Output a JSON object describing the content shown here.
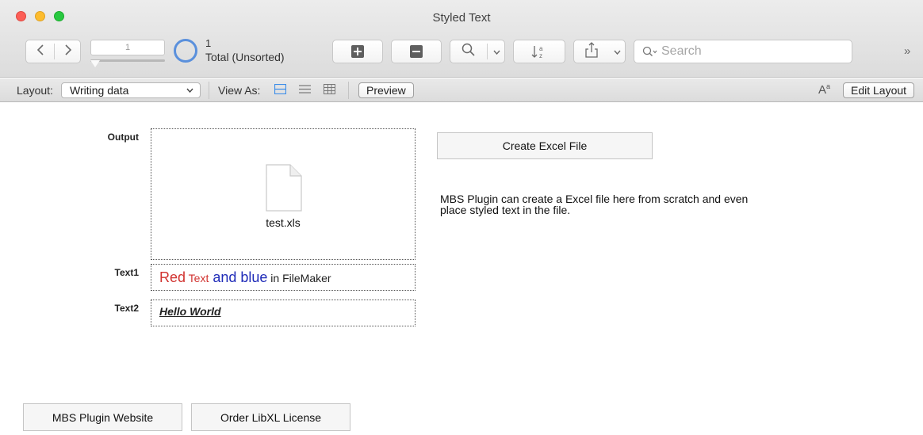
{
  "window": {
    "title": "Styled Text"
  },
  "toolbar": {
    "record_number": "1",
    "found_count": "1",
    "found_status": "Total (Unsorted)",
    "search_placeholder": "Search",
    "overflow_glyph": "»"
  },
  "layout_bar": {
    "layout_label": "Layout:",
    "layout_value": "Writing data",
    "view_as_label": "View As:",
    "preview_label": "Preview",
    "edit_layout_label": "Edit Layout"
  },
  "form": {
    "output_label": "Output",
    "output_file_name": "test.xls",
    "text1_label": "Text1",
    "text1_value": {
      "part1": "Red",
      "part2": " Text",
      "part3": " and blue",
      "part4": " in FileMaker"
    },
    "text2_label": "Text2",
    "text2_value": "Hello World",
    "create_button": "Create Excel File",
    "description": "MBS Plugin can create a Excel file here from scratch and even place styled text in the file.",
    "website_button": "MBS Plugin Website",
    "license_button": "Order LibXL License"
  },
  "colors": {
    "red_text": "#d13330",
    "blue_text": "#1f2bb8",
    "accent": "#3d8ee8"
  }
}
